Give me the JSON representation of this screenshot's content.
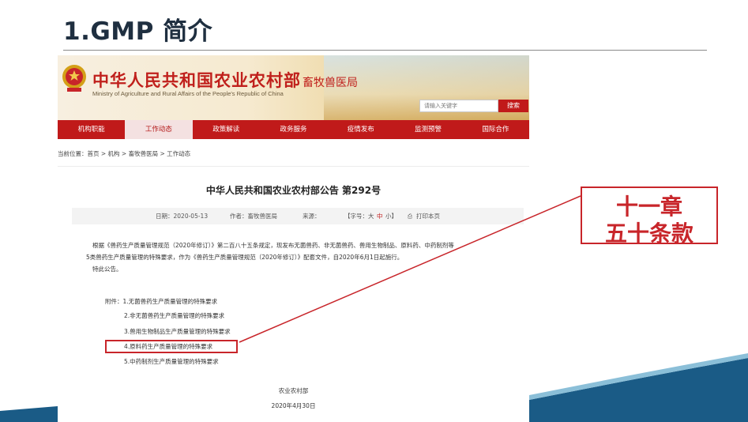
{
  "slide": {
    "title": "1.GMP 简介"
  },
  "site": {
    "name_cn": "中华人民共和国农业农村部",
    "name_en": "Ministry of Agriculture and Rural Affairs of the People's Republic of China",
    "bureau": "畜牧兽医局",
    "search_placeholder": "请输入关键字",
    "search_button": "搜索"
  },
  "nav": [
    "机构职能",
    "工作动态",
    "政策解读",
    "政务服务",
    "疫情发布",
    "监测预警",
    "国际合作"
  ],
  "breadcrumb": "当前位置：首页 > 机构 > 畜牧兽医局 > 工作动态",
  "article": {
    "title": "中华人民共和国农业农村部公告 第292号",
    "date": "日期：2020-05-13",
    "author": "作者：畜牧兽医局",
    "source": "来源：",
    "font_label": "【字号：",
    "font_large": "大",
    "font_medium": "中",
    "font_small": "小】",
    "print": "打印本页",
    "para1_line1": "根据《兽药生产质量管理规范（2020年修订）》第二百八十五条规定，现发布无菌兽药、非无菌兽药、兽用生物制品、原料药、中药制剂等",
    "para1_line2": "5类兽药生产质量管理的特殊要求，作为《兽药生产质量管理规范（2020年修订）》配套文件，自2020年6月1日起施行。",
    "para2": "特此公告。",
    "attach_label": "附件：1.无菌兽药生产质量管理的特殊要求",
    "attach_2": "2.非无菌兽药生产质量管理的特殊要求",
    "attach_3": "3.兽用生物制品生产质量管理的特殊要求",
    "attach_4": "4.原料药生产质量管理的特殊要求",
    "attach_5": "5.中药制剂生产质量管理的特殊要求",
    "signer": "农业农村部",
    "sign_date": "2020年4月30日"
  },
  "callout": {
    "line1": "十一章",
    "line2": "五十条款"
  },
  "colors": {
    "accent_red": "#c8252a",
    "nav_red": "#c01a1a",
    "deco_blue": "#1a5b86"
  }
}
